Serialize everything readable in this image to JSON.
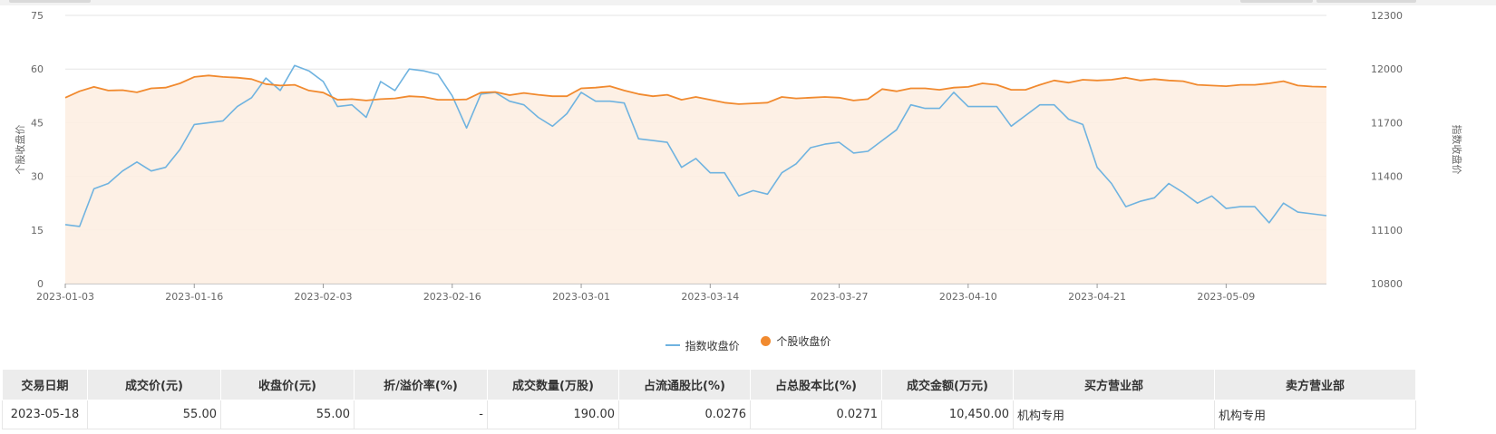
{
  "chart_data": {
    "type": "line",
    "x": [
      "2023-01-03",
      "2023-01-04",
      "2023-01-05",
      "2023-01-06",
      "2023-01-09",
      "2023-01-10",
      "2023-01-11",
      "2023-01-12",
      "2023-01-13",
      "2023-01-16",
      "2023-01-17",
      "2023-01-18",
      "2023-01-19",
      "2023-01-20",
      "2023-01-30",
      "2023-01-31",
      "2023-02-01",
      "2023-02-02",
      "2023-02-03",
      "2023-02-06",
      "2023-02-07",
      "2023-02-08",
      "2023-02-09",
      "2023-02-10",
      "2023-02-13",
      "2023-02-14",
      "2023-02-15",
      "2023-02-16",
      "2023-02-17",
      "2023-02-20",
      "2023-02-21",
      "2023-02-22",
      "2023-02-23",
      "2023-02-24",
      "2023-02-27",
      "2023-02-28",
      "2023-03-01",
      "2023-03-02",
      "2023-03-03",
      "2023-03-06",
      "2023-03-07",
      "2023-03-08",
      "2023-03-09",
      "2023-03-10",
      "2023-03-13",
      "2023-03-14",
      "2023-03-15",
      "2023-03-16",
      "2023-03-17",
      "2023-03-20",
      "2023-03-21",
      "2023-03-22",
      "2023-03-23",
      "2023-03-24",
      "2023-03-27",
      "2023-03-28",
      "2023-03-29",
      "2023-03-30",
      "2023-03-31",
      "2023-04-03",
      "2023-04-04",
      "2023-04-06",
      "2023-04-07",
      "2023-04-10",
      "2023-04-11",
      "2023-04-12",
      "2023-04-13",
      "2023-04-14",
      "2023-04-17",
      "2023-04-18",
      "2023-04-19",
      "2023-04-20",
      "2023-04-21",
      "2023-04-24",
      "2023-04-25",
      "2023-04-26",
      "2023-04-27",
      "2023-04-28",
      "2023-05-04",
      "2023-05-05",
      "2023-05-08",
      "2023-05-09",
      "2023-05-10",
      "2023-05-11",
      "2023-05-12",
      "2023-05-15",
      "2023-05-16",
      "2023-05-17",
      "2023-05-18"
    ],
    "x_ticks": [
      "2023-01-03",
      "2023-01-16",
      "2023-02-03",
      "2023-02-16",
      "2023-03-01",
      "2023-03-14",
      "2023-03-27",
      "2023-04-10",
      "2023-04-21",
      "2023-05-09"
    ],
    "series": [
      {
        "name": "指数收盘价",
        "axis": "right",
        "color": "#6fb3e0",
        "values": [
          11130,
          11120,
          11330,
          11360,
          11430,
          11480,
          11430,
          11450,
          11550,
          11690,
          11700,
          11710,
          11790,
          11840,
          11950,
          11880,
          12020,
          11990,
          11930,
          11790,
          11800,
          11730,
          11930,
          11880,
          12000,
          11990,
          11970,
          11850,
          11670,
          11860,
          11870,
          11820,
          11800,
          11730,
          11680,
          11750,
          11870,
          11820,
          11820,
          11810,
          11610,
          11600,
          11590,
          11450,
          11500,
          11420,
          11420,
          11290,
          11320,
          11300,
          11420,
          11470,
          11560,
          11580,
          11590,
          11530,
          11540,
          11600,
          11660,
          11800,
          11780,
          11780,
          11870,
          11790,
          11790,
          11790,
          11680,
          11740,
          11800,
          11800,
          11720,
          11690,
          11450,
          11360,
          11230,
          11260,
          11280,
          11360,
          11310,
          11250,
          11290,
          11220,
          11230,
          11230,
          11140,
          11250,
          11200,
          11190,
          11180
        ]
      },
      {
        "name": "个股收盘价",
        "axis": "left",
        "color": "#f18a2f",
        "values": [
          52.0,
          53.8,
          55.0,
          54.0,
          54.1,
          53.5,
          54.6,
          54.8,
          56.0,
          57.8,
          58.2,
          57.8,
          57.6,
          57.2,
          55.8,
          55.4,
          55.6,
          54.0,
          53.4,
          51.4,
          51.6,
          51.2,
          51.6,
          51.8,
          52.4,
          52.2,
          51.4,
          51.4,
          51.5,
          53.4,
          53.6,
          52.7,
          53.3,
          52.8,
          52.4,
          52.4,
          54.6,
          54.8,
          55.2,
          54.0,
          53.0,
          52.4,
          52.8,
          51.4,
          52.2,
          51.4,
          50.6,
          50.2,
          50.4,
          50.6,
          52.2,
          51.8,
          52.0,
          52.2,
          52.0,
          51.2,
          51.6,
          54.4,
          53.8,
          54.6,
          54.6,
          54.2,
          54.8,
          55.0,
          56.0,
          55.6,
          54.2,
          54.2,
          55.6,
          56.8,
          56.2,
          57.0,
          56.8,
          57.0,
          57.6,
          56.8,
          57.2,
          56.8,
          56.6,
          55.6,
          55.4,
          55.2,
          55.6,
          55.6,
          56.0,
          56.6,
          55.4,
          55.1,
          55.0
        ]
      }
    ],
    "y_left": {
      "label": "个股收盘价",
      "ylim": [
        0,
        75
      ],
      "ticks": [
        0,
        15,
        30,
        45,
        60,
        75
      ]
    },
    "y_right": {
      "label": "指数收盘价",
      "ylim": [
        10800,
        12300
      ],
      "ticks": [
        10800,
        11100,
        11400,
        11700,
        12000,
        12300
      ]
    },
    "grid": true,
    "legend": "bottom-center"
  },
  "table": {
    "headers": [
      "交易日期",
      "成交价(元)",
      "收盘价(元)",
      "折/溢价率(%)",
      "成交数量(万股)",
      "占流通股比(%)",
      "占总股本比(%)",
      "成交金额(万元)",
      "买方营业部",
      "卖方营业部"
    ],
    "rows": [
      [
        "2023-05-18",
        "55.00",
        "55.00",
        "-",
        "190.00",
        "0.0276",
        "0.0271",
        "10,450.00",
        "机构专用",
        "机构专用"
      ]
    ]
  }
}
